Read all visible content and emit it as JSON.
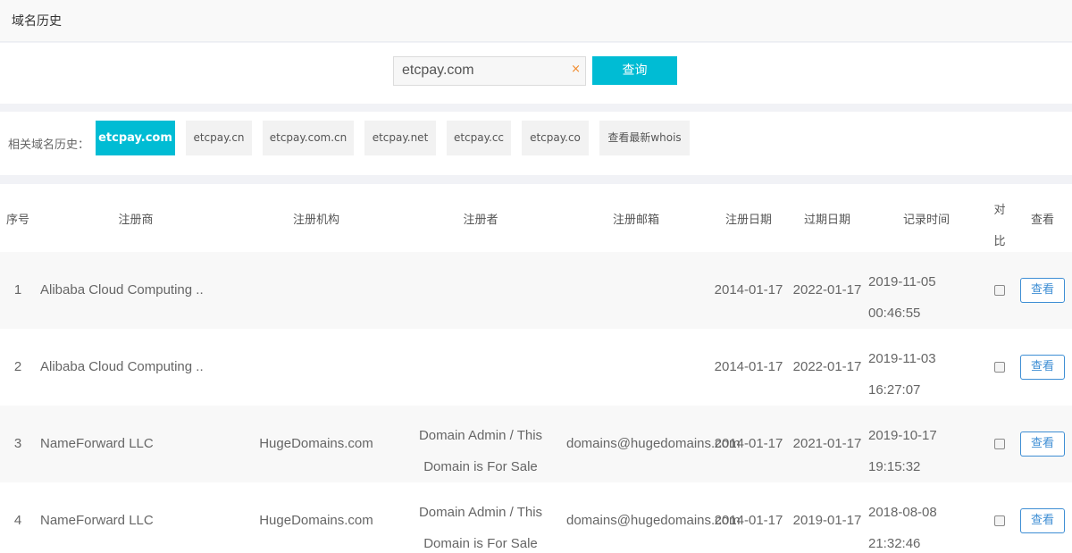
{
  "header": {
    "title": "域名历史"
  },
  "search": {
    "value": "etcpay.com",
    "clear_icon": "×",
    "button_label": "查询"
  },
  "related": {
    "label": "相关域名历史：",
    "chips": [
      {
        "label": "etcpay.com",
        "active": true
      },
      {
        "label": "etcpay.cn",
        "active": false
      },
      {
        "label": "etcpay.com.cn",
        "active": false
      },
      {
        "label": "etcpay.net",
        "active": false
      },
      {
        "label": "etcpay.cc",
        "active": false
      },
      {
        "label": "etcpay.co",
        "active": false
      },
      {
        "label": "查看最新whois",
        "active": false
      }
    ]
  },
  "table": {
    "headers": {
      "index": "序号",
      "registrar": "注册商",
      "org": "注册机构",
      "registrant": "注册者",
      "email": "注册邮箱",
      "reg_date": "注册日期",
      "exp_date": "过期日期",
      "record_time": "记录时间",
      "compare": "对比",
      "view": "查看"
    },
    "view_label": "查看",
    "rows": [
      {
        "index": "1",
        "registrar": "Alibaba Cloud Computing ..",
        "org": "",
        "registrant": "",
        "email": "",
        "reg_date": "2014-01-17",
        "exp_date": "2022-01-17",
        "record_date": "2019-11-05",
        "record_clock": "00:46:55"
      },
      {
        "index": "2",
        "registrar": "Alibaba Cloud Computing ..",
        "org": "",
        "registrant": "",
        "email": "",
        "reg_date": "2014-01-17",
        "exp_date": "2022-01-17",
        "record_date": "2019-11-03",
        "record_clock": "16:27:07"
      },
      {
        "index": "3",
        "registrar": "NameForward LLC",
        "org": "HugeDomains.com",
        "registrant": "Domain Admin / This Domain is For Sale",
        "email": "domains@hugedomains.com",
        "reg_date": "2014-01-17",
        "exp_date": "2021-01-17",
        "record_date": "2019-10-17",
        "record_clock": "19:15:32"
      },
      {
        "index": "4",
        "registrar": "NameForward LLC",
        "org": "HugeDomains.com",
        "registrant": "Domain Admin / This Domain is For Sale",
        "email": "domains@hugedomains.com",
        "reg_date": "2014-01-17",
        "exp_date": "2019-01-17",
        "record_date": "2018-08-08",
        "record_clock": "21:32:46"
      }
    ]
  }
}
